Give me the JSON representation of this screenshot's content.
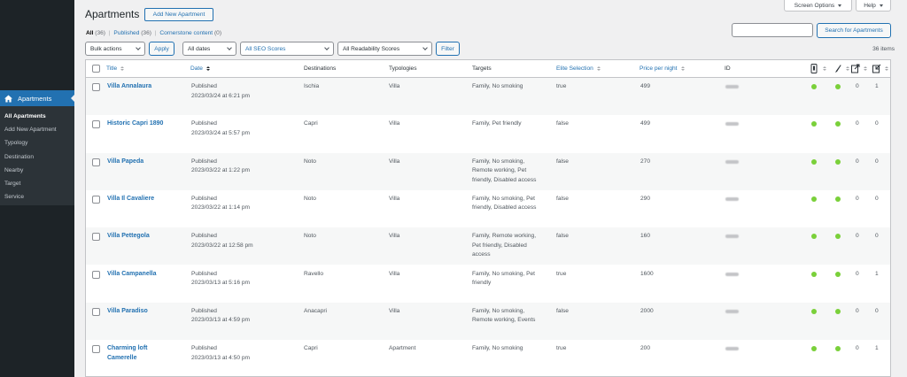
{
  "sidebar": {
    "current_label": "Apartments",
    "submenu": [
      "All Apartments",
      "Add New Apartment",
      "Typology",
      "Destination",
      "Nearby",
      "Target",
      "Service"
    ]
  },
  "screen_meta": {
    "screen_options": "Screen Options",
    "help": "Help"
  },
  "header": {
    "title": "Apartments",
    "add_new": "Add New Apartment"
  },
  "views": {
    "all": "All",
    "all_count": "(36)",
    "published": "Published",
    "published_count": "(36)",
    "cornerstone": "Cornerstone content",
    "cornerstone_count": "(0)"
  },
  "search": {
    "button": "Search for Apartments",
    "placeholder": ""
  },
  "filters": {
    "bulk": "Bulk actions",
    "apply": "Apply",
    "dates": "All dates",
    "seo": "All SEO Scores",
    "readability": "All Readability Scores",
    "filter": "Filter"
  },
  "items_count": "36 items",
  "columns": {
    "title": "Title",
    "date": "Date",
    "destinations": "Destinations",
    "typologies": "Typologies",
    "targets": "Targets",
    "elite": "Elite Selection",
    "price": "Price per night",
    "id": "ID"
  },
  "header_icons": [
    "seo-score-icon",
    "readability-icon",
    "outgoing-links-icon",
    "incoming-links-icon"
  ],
  "status_colors": {
    "good": "#7ad03a",
    "link": "#2271b1"
  },
  "rows": [
    {
      "title": "Villa Annalaura",
      "status": "Published",
      "date": "2023/03/24 at 6:21 pm",
      "destination": "Ischia",
      "typology": "Villa",
      "targets": "Family, No smoking",
      "elite": "true",
      "price": "499",
      "links_out": "0",
      "links_in": "1"
    },
    {
      "title": "Historic Capri 1890",
      "status": "Published",
      "date": "2023/03/24 at 5:57 pm",
      "destination": "Capri",
      "typology": "Villa",
      "targets": "Family, Pet friendly",
      "elite": "false",
      "price": "499",
      "links_out": "0",
      "links_in": "0"
    },
    {
      "title": "Villa Papeda",
      "status": "Published",
      "date": "2023/03/22 at 1:22 pm",
      "destination": "Noto",
      "typology": "Villa",
      "targets": "Family, No smoking,\nRemote working, Pet\nfriendly, Disabled access",
      "elite": "false",
      "price": "270",
      "links_out": "0",
      "links_in": "0"
    },
    {
      "title": "Villa Il Cavaliere",
      "status": "Published",
      "date": "2023/03/22 at 1:14 pm",
      "destination": "Noto",
      "typology": "Villa",
      "targets": "Family, No smoking, Pet\nfriendly, Disabled access",
      "elite": "false",
      "price": "290",
      "links_out": "0",
      "links_in": "0"
    },
    {
      "title": "Villa Pettegola",
      "status": "Published",
      "date": "2023/03/22 at 12:58 pm",
      "destination": "Noto",
      "typology": "Villa",
      "targets": "Family, Remote working,\nPet friendly, Disabled\naccess",
      "elite": "false",
      "price": "160",
      "links_out": "0",
      "links_in": "0"
    },
    {
      "title": "Villa Campanella",
      "status": "Published",
      "date": "2023/03/13 at 5:16 pm",
      "destination": "Ravello",
      "typology": "Villa",
      "targets": "Family, No smoking, Pet\nfriendly",
      "elite": "true",
      "price": "1600",
      "links_out": "0",
      "links_in": "1"
    },
    {
      "title": "Villa Paradiso",
      "status": "Published",
      "date": "2023/03/13 at 4:59 pm",
      "destination": "Anacapri",
      "typology": "Villa",
      "targets": "Family, No smoking,\nRemote working, Events",
      "elite": "false",
      "price": "2000",
      "links_out": "0",
      "links_in": "0"
    },
    {
      "title": "Charming loft\nCamerelle",
      "status": "Published",
      "date": "2023/03/13 at 4:50 pm",
      "destination": "Capri",
      "typology": "Apartment",
      "targets": "Family, No smoking",
      "elite": "true",
      "price": "200",
      "links_out": "0",
      "links_in": "1"
    }
  ]
}
